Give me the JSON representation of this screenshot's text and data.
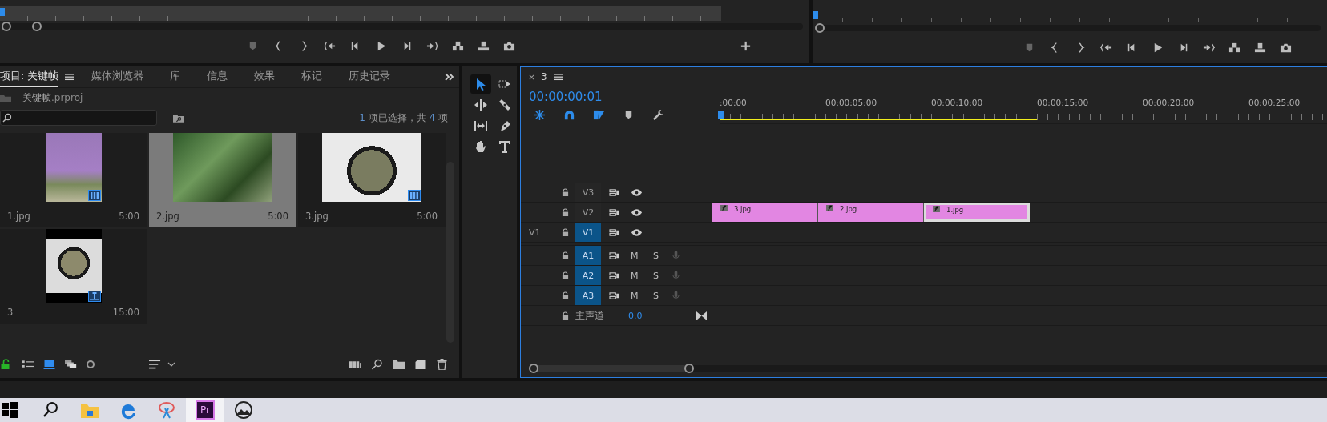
{
  "project_panel": {
    "tabs": [
      {
        "label": "项目: 关键帧",
        "selected": true
      },
      {
        "label": "媒体浏览器",
        "selected": false
      },
      {
        "label": "库",
        "selected": false
      },
      {
        "label": "信息",
        "selected": false
      },
      {
        "label": "效果",
        "selected": false
      },
      {
        "label": "标记",
        "selected": false
      },
      {
        "label": "历史记录",
        "selected": false
      }
    ],
    "project_file": {
      "name": "关键帧",
      "extension": ".prproj"
    },
    "selection_count": {
      "number": "1",
      "text": "项已选择，共",
      "total": "4",
      "unit": "项"
    },
    "items": [
      {
        "name": "1.jpg",
        "duration": "5:00",
        "kind": "still",
        "selected": false,
        "badge": true
      },
      {
        "name": "2.jpg",
        "duration": "5:00",
        "kind": "still",
        "selected": true,
        "badge": false
      },
      {
        "name": "3.jpg",
        "duration": "5:00",
        "kind": "still",
        "selected": false,
        "badge": true
      },
      {
        "name": "3",
        "duration": "15:00",
        "kind": "sequence",
        "selected": false,
        "badge": true
      }
    ],
    "zoom_slider": {
      "level": 0
    }
  },
  "tools": [
    {
      "kind": "selection",
      "selected": true
    },
    {
      "kind": "track-select",
      "selected": false
    },
    {
      "kind": "ripple",
      "selected": false
    },
    {
      "kind": "razor",
      "selected": false
    },
    {
      "kind": "slip",
      "selected": false
    },
    {
      "kind": "pen",
      "selected": false
    },
    {
      "kind": "hand",
      "selected": false
    },
    {
      "kind": "type",
      "selected": false
    }
  ],
  "timeline": {
    "tab": {
      "label": "3"
    },
    "timecode": "00:00:00:01",
    "toggles": [
      {
        "kind": "nest",
        "on": true
      },
      {
        "kind": "snap",
        "on": true
      },
      {
        "kind": "linked",
        "on": true
      },
      {
        "kind": "marker",
        "on": false
      },
      {
        "kind": "settings",
        "on": false
      }
    ],
    "ruler_labels": [
      ":00:00",
      "00:00:05:00",
      "00:00:10:00",
      "00:00:15:00",
      "00:00:20:00",
      "00:00:25:00"
    ],
    "video_tracks": [
      {
        "name": "V3",
        "targeted": false
      },
      {
        "name": "V2",
        "targeted": false,
        "clips": [
          {
            "name": "3.jpg",
            "selected": false
          },
          {
            "name": "2.jpg",
            "selected": false
          },
          {
            "name": "1.jpg",
            "selected": true
          }
        ]
      },
      {
        "name": "V1",
        "source": "V1",
        "targeted": true
      }
    ],
    "audio_tracks": [
      {
        "name": "A1",
        "targeted": true,
        "mute": "M",
        "solo": "S"
      },
      {
        "name": "A2",
        "targeted": true,
        "mute": "M",
        "solo": "S"
      },
      {
        "name": "A3",
        "targeted": true,
        "mute": "M",
        "solo": "S"
      }
    ],
    "master": {
      "label": "主声道",
      "value": "0.0"
    }
  },
  "taskbar": {
    "apps": [
      {
        "kind": "start",
        "active": false
      },
      {
        "kind": "search",
        "active": false
      },
      {
        "kind": "explorer",
        "active": false
      },
      {
        "kind": "browser",
        "active": false
      },
      {
        "kind": "snip",
        "active": false
      },
      {
        "kind": "premiere",
        "label": "Pr",
        "active": true
      },
      {
        "kind": "photos",
        "active": false
      }
    ]
  }
}
